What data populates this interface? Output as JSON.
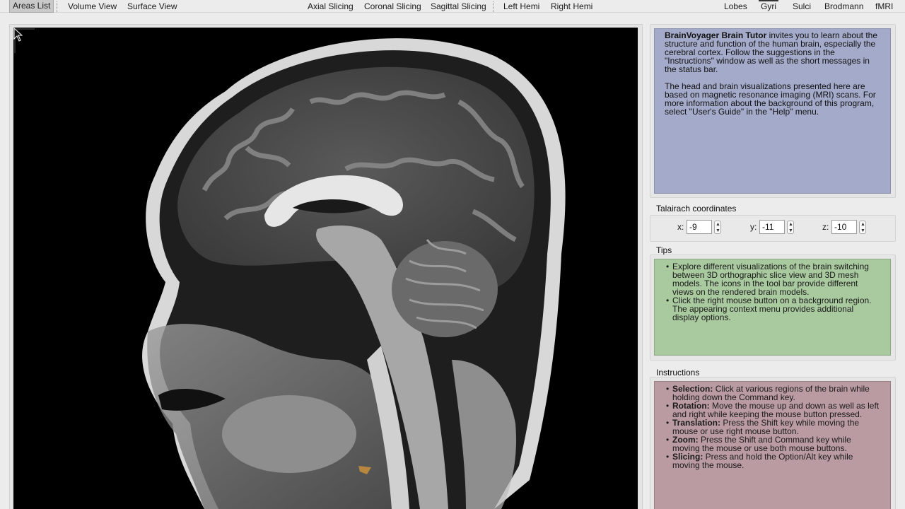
{
  "toolbar": {
    "left": [
      "Areas List",
      "Volume View",
      "Surface View"
    ],
    "middle": [
      "Axial Slicing",
      "Coronal Slicing",
      "Sagittal Slicing"
    ],
    "hemi": [
      "Left Hemi",
      "Right Hemi"
    ],
    "right": [
      "Lobes",
      "Gyri",
      "Sulci",
      "Brodmann",
      "fMRI"
    ],
    "selected": "Areas List"
  },
  "viewer": {
    "description_icon": "mouse-pointer-icon"
  },
  "info": {
    "app_name": "BrainVoyager Brain Tutor",
    "para1_rest": " invites you to learn about the structure and function of the human brain, especially the cerebral cortex. Follow the suggestions in the \"Instructions\" window as well as the short messages in the status bar.",
    "para2": "The head and brain visualizations presented here are based on magnetic resonance imaging (MRI) scans. For more information about the background of this program, select \"User's Guide\" in the \"Help\" menu."
  },
  "talairach": {
    "title": "Talairach coordinates",
    "x_label": "x:",
    "x_value": "-9",
    "y_label": "y:",
    "y_value": "-11",
    "z_label": "z:",
    "z_value": "-10"
  },
  "tips": {
    "title": "Tips",
    "items": [
      "Explore different visualizations of the brain switching between 3D orthographic slice view and 3D mesh models. The icons in the tool bar provide different views on the rendered brain models.",
      "Click the right mouse button on a background region. The appearing context menu provides additional display options."
    ]
  },
  "instructions": {
    "title": "Instructions",
    "items": [
      {
        "term": "Selection:",
        "text": " Click at various regions of the brain while holding down the Command key."
      },
      {
        "term": "Rotation:",
        "text": " Move the mouse up and down as well as left and right while keeping the mouse button pressed."
      },
      {
        "term": "Translation:",
        "text": " Press the Shift key while moving the mouse or use right mouse button."
      },
      {
        "term": "Zoom:",
        "text": " Press the Shift and Command key while moving the mouse or use both mouse buttons."
      },
      {
        "term": "Slicing:",
        "text": " Press and hold the Option/Alt key while moving the mouse."
      }
    ]
  },
  "colors": {
    "info_bg": "#a4aac9",
    "tips_bg": "#a9c99f",
    "instructions_bg": "#b99ba1"
  }
}
